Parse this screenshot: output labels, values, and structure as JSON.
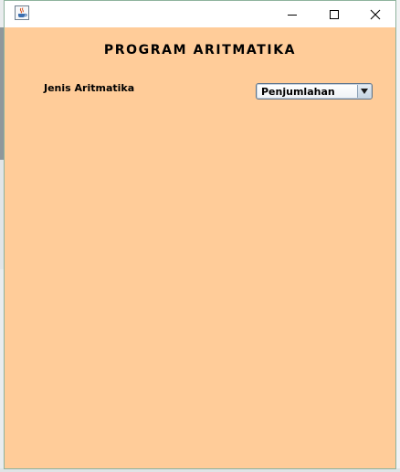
{
  "window": {
    "icon": "java-coffee-icon",
    "controls": {
      "minimize_icon": "minimize-icon",
      "maximize_icon": "maximize-icon",
      "close_icon": "close-icon"
    }
  },
  "form": {
    "title": "PROGRAM ARITMATIKA",
    "operation_label": "Jenis Aritmatika",
    "operation_selected": "Penjumlahan",
    "dropdown_icon": "triangle-down-icon"
  },
  "colors": {
    "content_background": "#ffcc99",
    "titlebar_background": "#ffffff",
    "window_border": "#8fb39d"
  }
}
